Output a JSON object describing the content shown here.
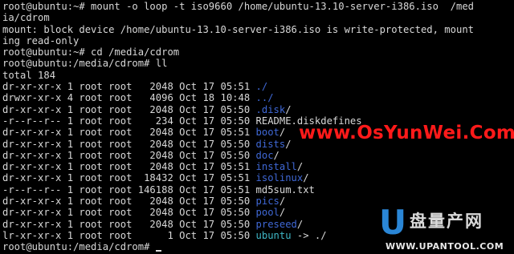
{
  "terminal": {
    "lines": [
      "root@ubuntu:~# mount -o loop -t iso9660 /home/ubuntu-13.10-server-i386.iso  /med",
      "ia/cdrom",
      "mount: block device /home/ubuntu-13.10-server-i386.iso is write-protected, mount",
      "ing read-only",
      "root@ubuntu:~# cd /media/cdrom",
      "root@ubuntu:/media/cdrom# ll",
      "total 184"
    ],
    "listing": [
      {
        "meta": "dr-xr-xr-x 1 root root   2048 Oct 17 05:51 ",
        "name": "./",
        "suffix": "",
        "kind": "dir"
      },
      {
        "meta": "drwxr-xr-x 4 root root   4096 Oct 18 10:48 ",
        "name": "../",
        "suffix": "",
        "kind": "dir"
      },
      {
        "meta": "dr-xr-xr-x 1 root root   2048 Oct 17 05:50 ",
        "name": ".disk",
        "suffix": "/",
        "kind": "dir"
      },
      {
        "meta": "-r--r--r-- 1 root root    234 Oct 17 05:50 ",
        "name": "README.diskdefines",
        "suffix": "",
        "kind": "file"
      },
      {
        "meta": "dr-xr-xr-x 1 root root   2048 Oct 17 05:51 ",
        "name": "boot",
        "suffix": "/",
        "kind": "dir"
      },
      {
        "meta": "dr-xr-xr-x 1 root root   2048 Oct 17 05:50 ",
        "name": "dists",
        "suffix": "/",
        "kind": "dir"
      },
      {
        "meta": "dr-xr-xr-x 1 root root   2048 Oct 17 05:50 ",
        "name": "doc",
        "suffix": "/",
        "kind": "dir"
      },
      {
        "meta": "dr-xr-xr-x 1 root root   2048 Oct 17 05:51 ",
        "name": "install",
        "suffix": "/",
        "kind": "dir"
      },
      {
        "meta": "dr-xr-xr-x 1 root root  18432 Oct 17 05:51 ",
        "name": "isolinux",
        "suffix": "/",
        "kind": "dir"
      },
      {
        "meta": "-r--r--r-- 1 root root 146188 Oct 17 05:51 ",
        "name": "md5sum.txt",
        "suffix": "",
        "kind": "file"
      },
      {
        "meta": "dr-xr-xr-x 1 root root   2048 Oct 17 05:50 ",
        "name": "pics",
        "suffix": "/",
        "kind": "dir"
      },
      {
        "meta": "dr-xr-xr-x 1 root root   2048 Oct 17 05:50 ",
        "name": "pool",
        "suffix": "/",
        "kind": "dir"
      },
      {
        "meta": "dr-xr-xr-x 1 root root   2048 Oct 17 05:50 ",
        "name": "preseed",
        "suffix": "/",
        "kind": "dir"
      },
      {
        "meta": "lr-xr-xr-x 1 root root      1 Oct 17 05:50 ",
        "name": "ubuntu",
        "suffix": " -> ./",
        "kind": "link"
      }
    ],
    "final_prompt": "root@ubuntu:/media/cdrom# ",
    "colors": {
      "background": "#000000",
      "text": "#d8d8d8",
      "directory": "#3f68d6",
      "symlink": "#3fb8c8"
    }
  },
  "watermark": {
    "text": "www.OsYunWei.Com",
    "color": "#ff1a1a"
  },
  "logo": {
    "mark": "U",
    "chinese": "盘量产网",
    "url": "WWW.UPANTOOL.COM",
    "accent": "#2a86d6"
  }
}
